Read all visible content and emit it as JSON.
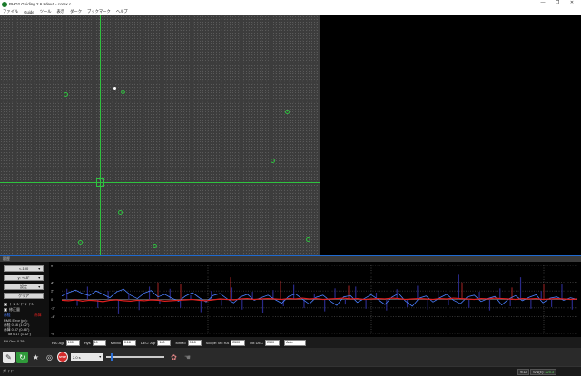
{
  "window": {
    "title": "PHD2 Guiding 2.6.9dev4 - corex.c",
    "min": "—",
    "restore": "❐",
    "close": "✕"
  },
  "menu": [
    "ファイル",
    "Guide",
    "ツール",
    "表示",
    "ダーク",
    "ブックマーク",
    "ヘルプ"
  ],
  "graph": {
    "header": "履歴",
    "buttons": [
      {
        "label": "<-100",
        "dropdown": true
      },
      {
        "label": "y: +/-8\"",
        "dropdown": true
      },
      {
        "label": "設定",
        "dropdown": true
      },
      {
        "label": "クリア",
        "dropdown": false
      }
    ],
    "checkboxes": [
      "トレンドライン",
      "修正量"
    ],
    "legend": {
      "ra": "赤経",
      "dec": "赤緯"
    },
    "stats": {
      "rms_title": "RMS Error (px):",
      "ra": "赤経 0.16 (1.02\")",
      "dec": "赤緯 0.07 (0.46\")",
      "tot": "Tot 0.17 (1.12\")",
      "osc": "RA Osc: 0.29"
    },
    "y_ticks": [
      "8\"",
      "4\"",
      "2\"",
      "0",
      "-2\"",
      "-4\"",
      "-8\""
    ],
    "colors": {
      "ra": "#4b7fff",
      "dec": "#e0201f"
    }
  },
  "controls": {
    "ra_agr_label": "RA: Agr",
    "ra_agr": "100",
    "hys_label": "Hys",
    "hys": "10",
    "mnmo_label": "MnMo",
    "mnmo": "0.18",
    "dec_agr_label": "DEC: Agr",
    "dec_agr": "100",
    "dec_mnmo_label": "MnMo",
    "dec_mnmo": "0.18",
    "scope_label": "Scope: Mx RA",
    "mx_ra": "2500",
    "mx_dec_label": "Mx DEC",
    "mx_dec": "2500",
    "mode": "Auto"
  },
  "toolbar": {
    "exposure": "2.0 s",
    "stop": "STOP",
    "slider_fraction": 0.08
  },
  "status": {
    "text": "ガイド",
    "frame": "9/12",
    "snr_label": "S/N(E):",
    "snr": "225.3"
  },
  "chart_data": {
    "type": "line",
    "ylim": [
      -8,
      8
    ],
    "series": [
      {
        "name": "赤経",
        "values": [
          0.8,
          1.6,
          2.2,
          1.4,
          0.9,
          2.0,
          1.2,
          0.4,
          1.8,
          2.4,
          1.0,
          0.2,
          1.5,
          2.1,
          0.6,
          1.2,
          0.3,
          -0.4,
          0.8,
          1.6,
          0.4,
          -0.6,
          0.9,
          1.4,
          0.2,
          -0.8,
          0.6,
          1.2,
          -0.2,
          0.4,
          1.0,
          0.0,
          -0.9,
          0.7,
          1.3,
          0.1,
          -1.1,
          0.5,
          1.0,
          -0.3,
          -1.4,
          0.6,
          0.9,
          -0.7,
          0.2,
          1.1,
          0.0,
          -1.2,
          0.5,
          1.4,
          -0.4,
          -1.6,
          0.3,
          0.8,
          -0.6,
          0.4,
          1.2,
          -0.2,
          -1.0,
          0.6,
          1.0,
          -0.5,
          0.2,
          0.7,
          -1.3,
          0.1,
          0.9,
          -0.3,
          0.5,
          1.1,
          -0.8,
          0.3,
          0.6,
          -0.2,
          0.4,
          0.0
        ]
      },
      {
        "name": "赤緯",
        "values": [
          -0.2,
          -0.3,
          -0.1,
          -0.4,
          -0.2,
          -0.3,
          -0.5,
          -0.2,
          -0.1,
          -0.3,
          -0.4,
          -0.2,
          -0.3,
          -0.1,
          -0.2,
          -0.4,
          -0.3,
          -0.2,
          -0.1,
          0.0,
          -0.2,
          -0.3,
          -0.1,
          0.1,
          0.0,
          -0.1,
          0.1,
          0.2,
          0.0,
          0.1,
          0.2,
          0.1,
          0.0,
          0.2,
          0.1,
          0.3,
          0.1,
          0.2,
          0.0,
          0.1,
          0.2,
          0.3,
          0.1,
          0.2,
          0.0,
          0.1,
          0.2,
          0.1,
          0.3,
          0.2,
          0.0,
          0.1,
          0.2,
          0.1,
          0.0,
          0.2,
          0.1,
          0.3,
          0.2,
          0.1,
          0.0,
          0.2,
          0.1,
          0.3,
          0.2,
          0.1,
          0.0,
          0.2,
          0.1,
          0.2,
          0.0,
          0.1,
          0.2,
          0.1,
          0.0,
          0.1
        ]
      }
    ],
    "corrections_ra": [
      2.5,
      -1.5,
      3.0,
      -2.0,
      2.0,
      -3.5,
      1.5,
      -2.5,
      3.0,
      -1.0,
      2.5,
      -2.0,
      1.0,
      -3.0,
      2.0,
      -1.5,
      2.8,
      -2.4,
      1.8,
      -3.2,
      2.2,
      -1.6,
      3.4,
      -2.0,
      1.4,
      -2.8,
      2.6,
      -1.2,
      3.0,
      -2.2,
      1.6,
      -2.6,
      2.4,
      -1.8,
      3.2,
      -2.4,
      2.0,
      -1.4,
      6.0,
      -2.0,
      1.8,
      -2.6,
      2.6,
      -1.6,
      5.2,
      -2.2,
      2.0,
      -1.8,
      3.6,
      -2.4
    ],
    "corrections_dec": [
      4.0,
      3.6,
      5.2,
      4.4,
      3.2,
      4.0,
      2.8,
      3.6
    ]
  }
}
